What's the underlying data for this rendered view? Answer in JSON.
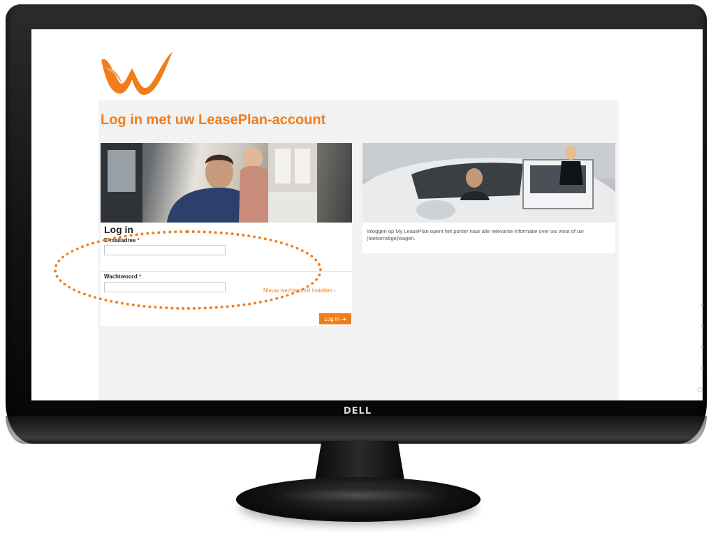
{
  "brand": {
    "logo_text": "LeasePlan",
    "accent_color": "#f07d1a",
    "monitor_brand": "DELL"
  },
  "page": {
    "title": "Log in met uw LeasePlan-account"
  },
  "login_form": {
    "heading": "Log in",
    "email_label": "E-mailadres",
    "email_value": "",
    "password_label": "Wachtwoord",
    "password_value": "",
    "required_marker": "*",
    "reset_password_link": "Nieuw wachtwoord instellen",
    "reset_icon": "chevron-right-icon",
    "submit_label": "Log in",
    "submit_icon": "arrow-right-icon"
  },
  "info": {
    "text": "Inloggen op My LeasePlan opent het portier naar alle relevante informatie over uw vloot of uw (toekomstige)wagen."
  },
  "annotation": {
    "highlight_color": "#f07d1a"
  }
}
